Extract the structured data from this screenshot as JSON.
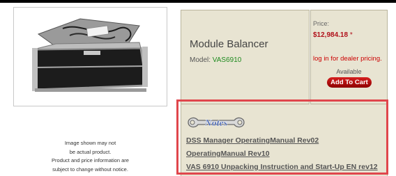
{
  "product": {
    "title": "Module Balancer",
    "model_label": "Model:",
    "model_value": "VAS6910",
    "photo_icon": "equipment-case-photo"
  },
  "disclaimer": [
    "Image shown may not",
    "be actual product.",
    "Product and price information are",
    "subject to change without notice."
  ],
  "pricing": {
    "label": "Price:",
    "value": "$12,984.18",
    "marker": "*",
    "dealer_link": "log in for dealer pricing.",
    "availability": "Available",
    "cart_button": "Add To Cart"
  },
  "notes": {
    "badge_text": "Notes",
    "badge_icon": "wrench-icon",
    "documents": [
      "DSS Manager OperatingManual Rev02",
      "OperatingManual Rev10",
      "VAS 6910 Unpacking Instruction and Start-Up EN rev12"
    ]
  },
  "colors": {
    "panel": "#e8e4d2",
    "price": "#b0101a",
    "model": "#1e8a1e",
    "highlight": "#e0464c"
  }
}
